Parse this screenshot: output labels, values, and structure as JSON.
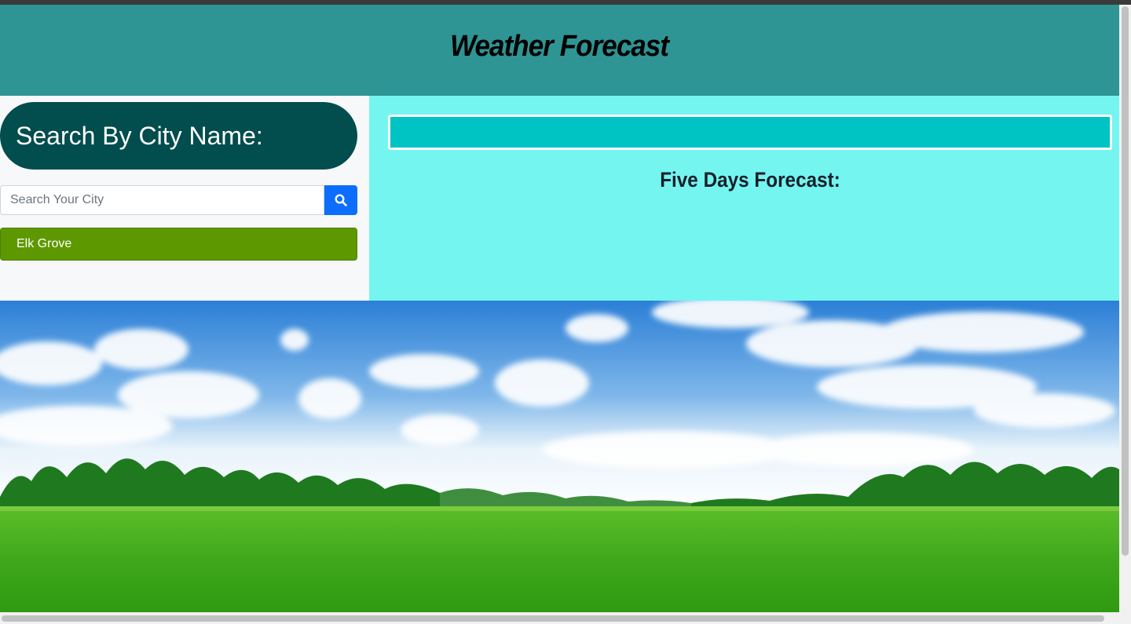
{
  "header": {
    "title": "Weather Forecast"
  },
  "sidebar": {
    "heading": "Search By City Name:",
    "search": {
      "placeholder": "Search Your City",
      "value": "",
      "button_icon": "search-icon"
    },
    "history": [
      "Elk Grove"
    ]
  },
  "main": {
    "current_weather": "",
    "forecast_title": "Five Days Forecast:"
  },
  "colors": {
    "header_bg": "#2e9494",
    "sidebar_heading_bg": "#024d4d",
    "main_bg": "#75f5f0",
    "current_box_bg": "#00c4c4",
    "search_button": "#0d6efd",
    "history_button": "#5e9800"
  }
}
